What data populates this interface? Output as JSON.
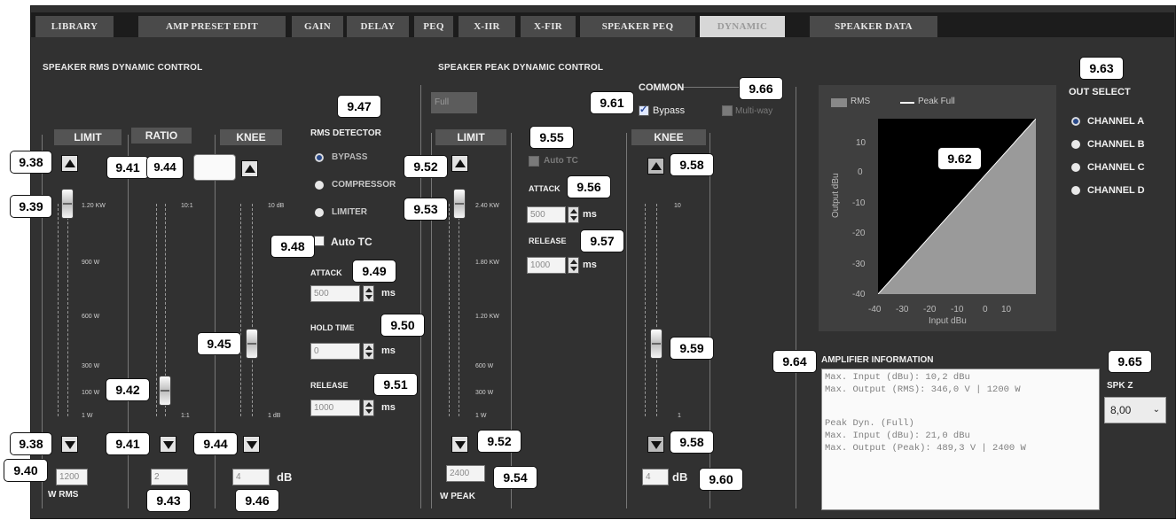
{
  "tabs": [
    "LIBRARY",
    "AMP PRESET EDIT",
    "GAIN",
    "DELAY",
    "PEQ",
    "X-IIR",
    "X-FIR",
    "SPEAKER PEQ",
    "DYNAMIC",
    "SPEAKER DATA"
  ],
  "active_tab": "DYNAMIC",
  "rms": {
    "title": "SPEAKER RMS DYNAMIC CONTROL",
    "limit": {
      "header": "LIMIT",
      "ticks": [
        "1.20 KW",
        "900 W",
        "600 W",
        "300 W",
        "100 W",
        "1 W"
      ],
      "value": "1200",
      "unit": "W RMS"
    },
    "ratio": {
      "header": "RATIO",
      "ticks": [
        "10:1",
        "1:1"
      ],
      "value": "2"
    },
    "knee": {
      "header": "KNEE",
      "ticks": [
        "10 dB",
        "1 dB"
      ],
      "value": "4",
      "unit": "dB"
    },
    "detector": {
      "title": "RMS DETECTOR",
      "options": [
        "BYPASS",
        "COMPRESSOR",
        "LIMITER"
      ],
      "selected": "BYPASS"
    },
    "auto_tc": "Auto TC",
    "attack": {
      "label": "ATTACK",
      "value": "500",
      "unit": "ms"
    },
    "hold": {
      "label": "HOLD TIME",
      "value": "0",
      "unit": "ms"
    },
    "release": {
      "label": "RELEASE",
      "value": "1000",
      "unit": "ms"
    }
  },
  "peak": {
    "title": "SPEAKER PEAK DYNAMIC CONTROL",
    "mode": "Full",
    "limit": {
      "header": "LIMIT",
      "ticks": [
        "2.40 KW",
        "1.80 KW",
        "1.20 KW",
        "600 W",
        "300 W",
        "1 W"
      ],
      "value": "2400",
      "unit": "W PEAK"
    },
    "auto_tc": "Auto TC",
    "attack": {
      "label": "ATTACK",
      "value": "500",
      "unit": "ms"
    },
    "release": {
      "label": "RELEASE",
      "value": "1000",
      "unit": "ms"
    },
    "knee": {
      "header": "KNEE",
      "ticks": [
        "10",
        "1"
      ],
      "value": "4",
      "unit": "dB"
    }
  },
  "common": {
    "title": "COMMON",
    "bypass": "Bypass",
    "bypass_checked": true,
    "multiway": "Multi-way"
  },
  "graph": {
    "legend_rms": "RMS",
    "legend_peak": "Peak Full",
    "ylabel": "Output dBu",
    "xlabel": "Input dBu",
    "yticks": [
      "10",
      "0",
      "-10",
      "-20",
      "-30",
      "-40"
    ],
    "xticks": [
      "-40",
      "-30",
      "-20",
      "-10",
      "0",
      "10"
    ]
  },
  "out_select": {
    "title": "OUT SELECT",
    "options": [
      "CHANNEL A",
      "CHANNEL B",
      "CHANNEL C",
      "CHANNEL D"
    ],
    "selected": "CHANNEL A"
  },
  "amp_info": {
    "title": "AMPLIFIER INFORMATION",
    "lines": [
      "Max. Input (dBu): 10,2 dBu",
      "Max. Output (RMS): 346,0 V | 1200 W",
      "",
      "Peak Dyn. (Full)",
      "Max. Input (dBu): 21,0 dBu",
      "Max. Output (Peak): 489,3 V | 2400 W"
    ]
  },
  "spk_z": {
    "label": "SPK Z",
    "value": "8,00"
  },
  "callouts": {
    "c938a": "9.38",
    "c938b": "9.38",
    "c939": "9.39",
    "c940": "9.40",
    "c941a": "9.41",
    "c941b": "9.41",
    "c942": "9.42",
    "c943": "9.43",
    "c944a": "9.44",
    "c944b": "9.44",
    "c945": "9.45",
    "c946": "9.46",
    "c947": "9.47",
    "c948": "9.48",
    "c949": "9.49",
    "c950": "9.50",
    "c951": "9.51",
    "c952a": "9.52",
    "c952b": "9.52",
    "c953": "9.53",
    "c954": "9.54",
    "c955": "9.55",
    "c956": "9.56",
    "c957": "9.57",
    "c958a": "9.58",
    "c958b": "9.58",
    "c959": "9.59",
    "c960": "9.60",
    "c961": "9.61",
    "c962": "9.62",
    "c963": "9.63",
    "c964": "9.64",
    "c965": "9.65",
    "c966": "9.66"
  },
  "colors": {
    "background": "#313131",
    "tab": "#4a4a4a",
    "tab_active": "#d7d7d7",
    "callout": "#ffffff"
  }
}
